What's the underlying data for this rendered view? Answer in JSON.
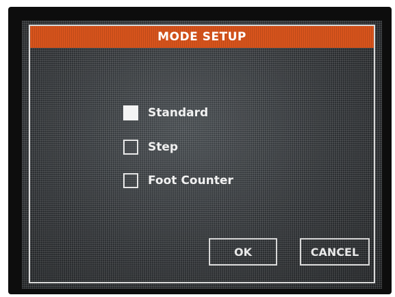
{
  "dialog": {
    "title": "MODE SETUP"
  },
  "options": [
    {
      "label": "Standard",
      "checked": true
    },
    {
      "label": "Step",
      "checked": false
    },
    {
      "label": "Foot Counter",
      "checked": false
    }
  ],
  "buttons": {
    "ok_label": "OK",
    "cancel_label": "CANCEL"
  },
  "colors": {
    "title_bar": "#d8541c",
    "screen_background": "#2d3033",
    "text": "#f0f0f0"
  }
}
